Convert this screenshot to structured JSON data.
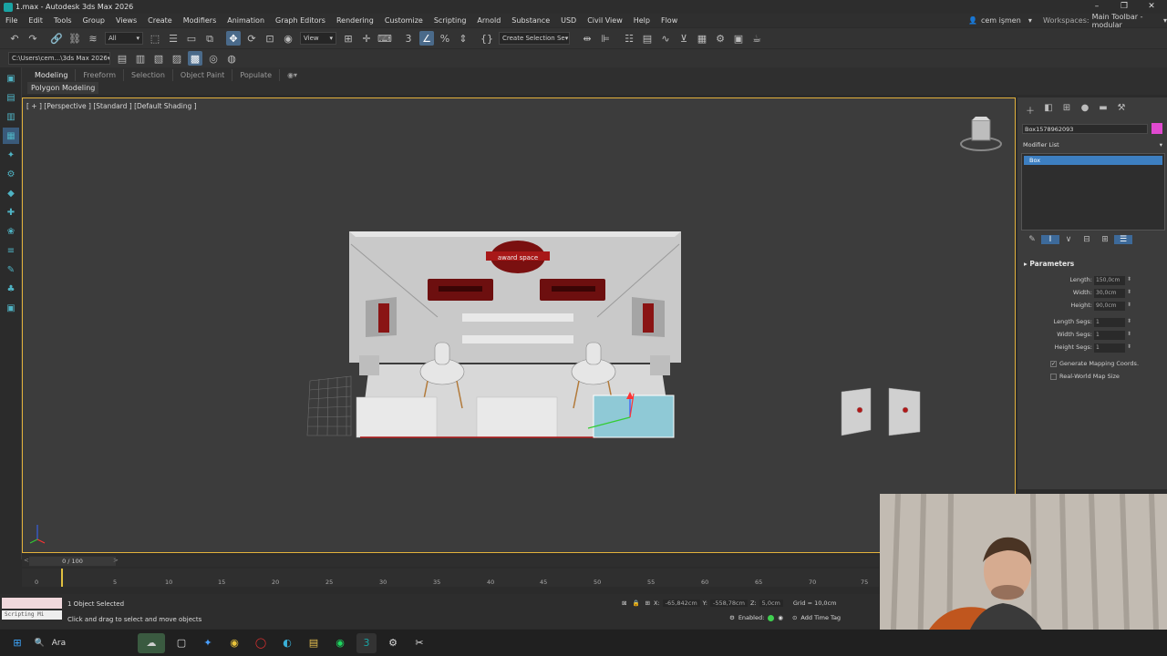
{
  "window": {
    "title": "1.max - Autodesk 3ds Max 2026",
    "minimize": "–",
    "maximize": "❐",
    "close": "✕"
  },
  "menu": [
    "File",
    "Edit",
    "Tools",
    "Group",
    "Views",
    "Create",
    "Modifiers",
    "Animation",
    "Graph Editors",
    "Rendering",
    "Customize",
    "Scripting",
    "Arnold",
    "Substance",
    "USD",
    "Civil View",
    "Help",
    "Flow"
  ],
  "user": {
    "name": "cem işmen",
    "workspaces_label": "Workspaces:",
    "workspace": "Main Toolbar - modular"
  },
  "toolbar": {
    "filter": "All",
    "view": "View",
    "selection_set": "Create Selection Se",
    "path": "C:\\Users\\cem...\\3ds Max 2026"
  },
  "ribbon": {
    "tabs": [
      "Modeling",
      "Freeform",
      "Selection",
      "Object Paint",
      "Populate"
    ],
    "active_tab": "Modeling",
    "sub_label": "Polygon Modeling"
  },
  "viewport": {
    "label": "[ + ] [Perspective ] [Standard ] [Default Shading ]",
    "sign_text": "award space"
  },
  "command_panel": {
    "object_name": "Box1578962093",
    "modifier_list": "Modifier List",
    "stack_item": "Box",
    "rollout": "Parameters",
    "params": [
      {
        "label": "Length:",
        "value": "150,0cm"
      },
      {
        "label": "Width:",
        "value": "30,0cm"
      },
      {
        "label": "Height:",
        "value": "90,0cm"
      },
      {
        "label": "Length Segs:",
        "value": "1"
      },
      {
        "label": "Width Segs:",
        "value": "1"
      },
      {
        "label": "Height Segs:",
        "value": "1"
      }
    ],
    "gen_mapping": "Generate Mapping Coords.",
    "real_world": "Real-World Map Size",
    "object_color": "#e04ad0"
  },
  "timeline": {
    "frame": "0 / 100",
    "ticks": [
      "0",
      "5",
      "10",
      "15",
      "20",
      "25",
      "30",
      "35",
      "40",
      "45",
      "50",
      "55",
      "60",
      "65",
      "70",
      "75"
    ]
  },
  "status": {
    "selected": "1 Object Selected",
    "prompt": "Click and drag to select and move objects",
    "script_label": "Scripting Mi",
    "x_label": "X:",
    "x": "-65,842cm",
    "y_label": "Y:",
    "y": "-558,78cm",
    "z_label": "Z:",
    "z": "5,0cm",
    "grid": "Grid = 10,0cm",
    "enabled": "Enabled:",
    "add_time_tag": "Add Time Tag"
  },
  "taskbar": {
    "search": "Ara"
  }
}
